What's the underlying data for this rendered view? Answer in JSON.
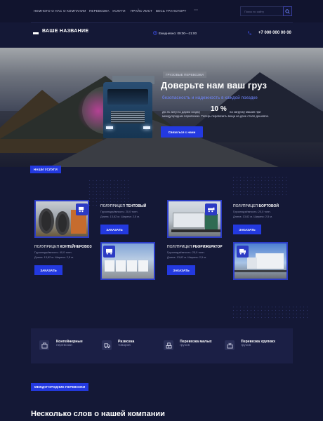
{
  "nav": {
    "links": [
      "НЕМНОГО О НАС",
      "О КОМПАНИИ",
      "ПЕРЕВОЗКА",
      "УСЛУГИ",
      "ПРАЙС-ЛИСТ",
      "ВЕСЬ ТРАНСПОРТ"
    ],
    "more": "⋯",
    "search_placeholder": "Поиск по сайту"
  },
  "header": {
    "brand": "ВАШЕ НАЗВАНИЕ",
    "hours": "Ежедневно: 09:00—21:00",
    "phone": "+7 000 000 00 00"
  },
  "hero": {
    "tag": "ГРУЗОВЫЕ ПЕРЕВОЗКИ",
    "title": "Доверьте нам ваш груз",
    "subtitle": "безопасность и надежность в каждой поездке",
    "desc_before": "До 31 августа дарим скидку",
    "percent": "10 %",
    "desc_after": "на загрузку машин при",
    "desc_line2": "междугородних перевозках. Теперь перевозить вещи на даче стало дешевле.",
    "button": "Связаться с нами"
  },
  "services": {
    "tag": "НАШИ УСЛУГИ",
    "spec_carry_label": "Грузоподъёмность",
    "items": [
      {
        "prefix": "ПОЛУПРИЦЕП",
        "name": "ТЕНТОВЫЙ",
        "carry": "Грузоподъёмность: 20,0 тонн.",
        "dims": "Длина: 13,62 м. Ширина: 2,5 м.",
        "button": "ЗАКАЗАТЬ"
      },
      {
        "prefix": "ПОЛУПРИЦЕП",
        "name": "БОРТОВОЙ",
        "carry": "Грузоподъёмность: 20,0 тонн.",
        "dims": "Длина: 13,62 м. Ширина: 2,5 м.",
        "button": "ЗАКАЗАТЬ"
      },
      {
        "prefix": "ПОЛУПРИЦЕП",
        "name": "КОНТЕЙНЕРОВОЗ",
        "carry": "Грузоподъёмность: 40,0 тонн.",
        "dims": "Длина: 13,62 м. Ширина: 2,5 м.",
        "button": "ЗАКАЗАТЬ"
      },
      {
        "prefix": "ПОЛУПРИЦЕП",
        "name": "РЕФРИЖЕРАТОР",
        "carry": "Грузоподъёмность: 25,0 тонн.",
        "dims": "Длина: 13,62 м. Ширина: 2,5 м.",
        "button": "ЗАКАЗАТЬ"
      }
    ]
  },
  "features": [
    {
      "title": "Контейнерные",
      "sub": "перевозки",
      "icon": "container-icon"
    },
    {
      "title": "Развозка",
      "sub": "товаров",
      "icon": "delivery-truck-icon"
    },
    {
      "title": "Перевозка малых",
      "sub": "грузов",
      "icon": "boxes-icon"
    },
    {
      "title": "Перевозка хрупких",
      "sub": "грузов",
      "icon": "fragile-box-icon"
    }
  ],
  "international": {
    "tag": "МЕЖДУГОРОДНИЕ ПЕРЕВОЗКИ"
  },
  "about": {
    "title": "Несколько слов о нашей компании"
  },
  "colors": {
    "accent": "#2339e0",
    "background": "#141836",
    "highlight": "#6f86ff"
  }
}
